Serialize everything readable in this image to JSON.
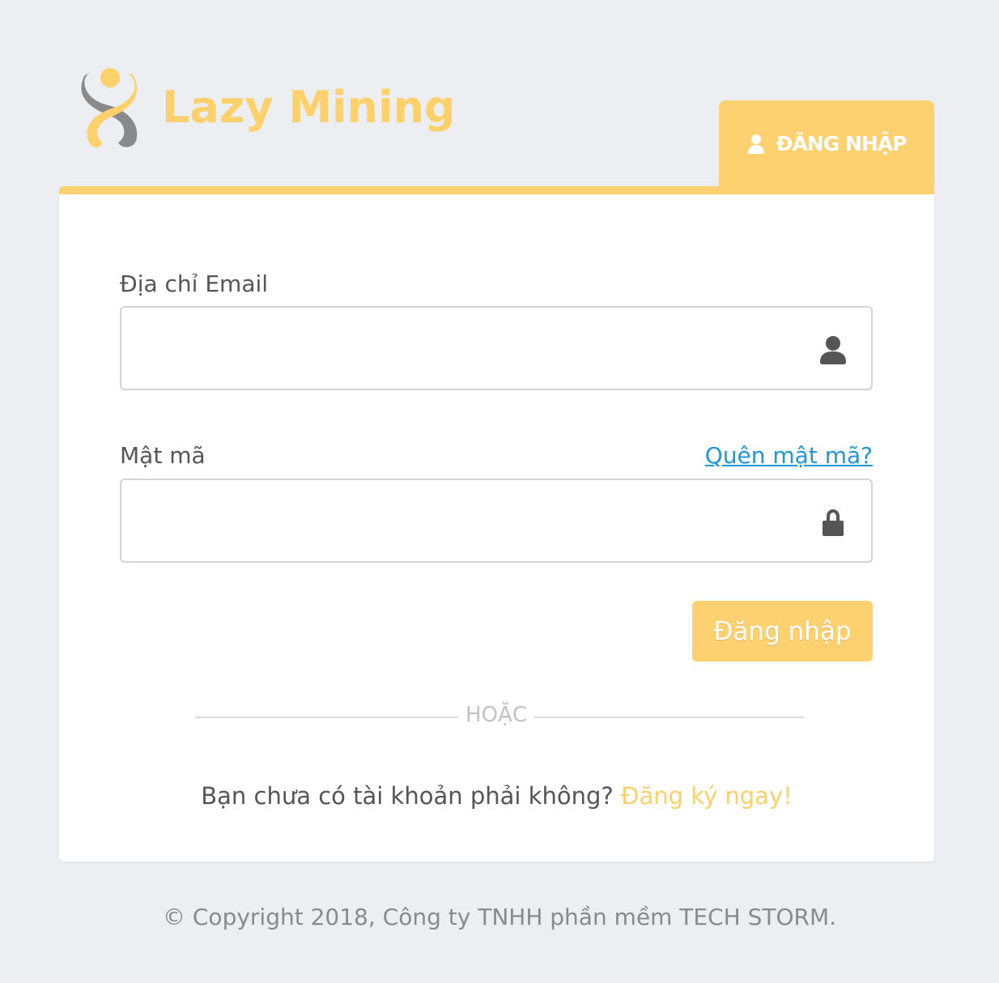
{
  "brand": {
    "name": "Lazy Mining",
    "color": "#fcd16c",
    "logo_icon": "figure-8-person-logo"
  },
  "tab": {
    "label": "ĐĂNG NHẬP",
    "icon": "user-icon",
    "color": "#fdd170"
  },
  "form": {
    "email_label": "Địa chỉ Email",
    "email_value": "",
    "email_icon": "user-icon",
    "password_label": "Mật mã",
    "password_value": "",
    "password_icon": "lock-icon",
    "forgot_link": "Quên mật mã?",
    "submit_label": "Đăng nhập"
  },
  "divider": {
    "text": "HOẶC"
  },
  "signup": {
    "prompt": "Bạn chưa có tài khoản phải không?",
    "link": "Đăng ký ngay!"
  },
  "footer": {
    "copyright": "© Copyright 2018, Công ty TNHH phần mềm TECH STORM."
  },
  "colors": {
    "accent": "#fdd170",
    "link": "#2196d9",
    "background": "#edeef1"
  }
}
